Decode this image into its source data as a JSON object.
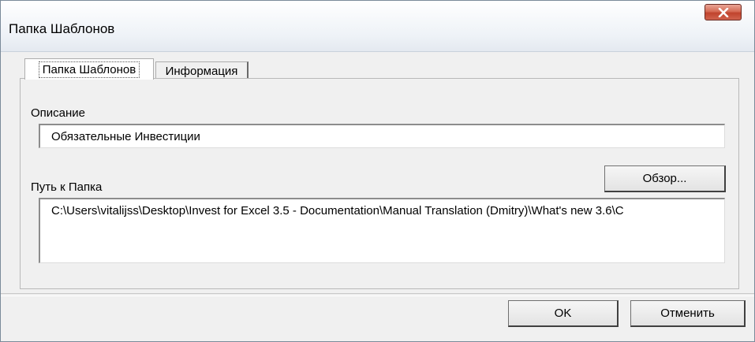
{
  "window": {
    "title": "Папка Шаблонов"
  },
  "tabs": [
    {
      "label": "Папка Шаблонов",
      "active": true
    },
    {
      "label": "Информация",
      "active": false
    }
  ],
  "description": {
    "label": "Описание",
    "value": "Обязательные Инвестиции"
  },
  "path": {
    "label": "Путь к Папка",
    "browse_label": "Обзор...",
    "value": "C:\\Users\\vitalijss\\Desktop\\Invest for Excel 3.5 - Documentation\\Manual Translation (Dmitry)\\What's new 3.6\\C"
  },
  "footer": {
    "ok_label": "OK",
    "cancel_label": "Отменить"
  },
  "colors": {
    "close_button": "#c0432d",
    "dialog_background": "#f0f0f0"
  }
}
